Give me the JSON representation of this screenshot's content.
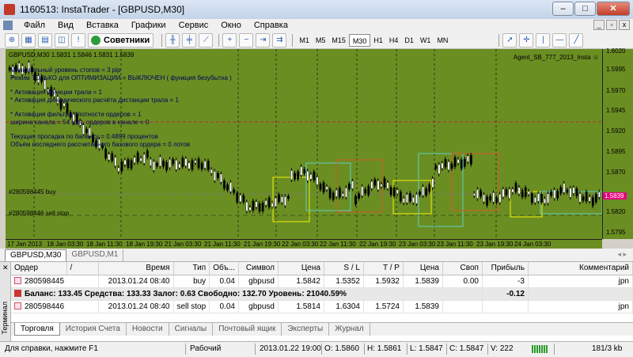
{
  "window": {
    "title": "1160513: InstaTrader - [GBPUSD,M30]",
    "minimize": "‒",
    "maximize": "□",
    "close": "✕"
  },
  "menu": [
    "Файл",
    "Вид",
    "Вставка",
    "Графики",
    "Сервис",
    "Окно",
    "Справка"
  ],
  "mdi_buttons": [
    "_",
    "▫",
    "x"
  ],
  "toolbar": {
    "advisors_label": "Советники",
    "timeframes": [
      "M1",
      "M5",
      "M15",
      "M30",
      "H1",
      "H4",
      "D1",
      "W1",
      "MN"
    ],
    "active_timeframe": "M30"
  },
  "chart": {
    "header": "GBPUSD,M30  1.5831 1.5846 1.5831 1.5839",
    "expert": "Agent_SB_777_2013_Insta ☺",
    "comments": [
      "Минимальный уровень стопов = 3 pip",
      "Режим ТОЛЬКО для ОПТИМИЗАЦИИ = ВЫКЛЮЧЕН ( функция безубытка )",
      "* Активация функции трала = 1",
      "* Активация динамического расчёта дистанции трала = 1",
      "* Активация фильтра плотности ордеров = 1",
      "ширина канала = 54 (pp), ордеров в канале = 0",
      "Текущая просадка по балансу = 0.4899 процентов",
      "Объём последнего рассчитанного базового ордера = 0 лотов"
    ],
    "buy_label": "#280598445 buy",
    "sell_label": "#280598446 sell stop",
    "price_ticks": [
      "1.6020",
      "1.5995",
      "1.5970",
      "1.5945",
      "1.5920",
      "1.5895",
      "1.5870",
      "1.5845",
      "1.5820",
      "1.5795"
    ],
    "current_price": "1.5839",
    "time_ticks": [
      "17 Jan 2013",
      "18 Jan 03:30",
      "18 Jan 11:30",
      "18 Jan 19:30",
      "21 Jan 03:30",
      "21 Jan 11:30",
      "21 Jan 19:30",
      "22 Jan 03:30",
      "22 Jan 11:30",
      "22 Jan 19:30",
      "23 Jan 03:30",
      "23 Jan 11:30",
      "23 Jan 19:30",
      "24 Jan 03:30"
    ],
    "colors": {
      "background": "#6b8e23",
      "bull": "#ffffff",
      "bear": "#000000",
      "buy_line": "#7a7a7a",
      "stop_line": "#b03030"
    }
  },
  "chart_tabs": [
    "GBPUSD,M30",
    "GBPUSD,M1"
  ],
  "terminal": {
    "side_label": "Терминал",
    "columns": [
      "Ордер",
      "/",
      "Время",
      "Тип",
      "Объ...",
      "Символ",
      "Цена",
      "S / L",
      "T / P",
      "Цена",
      "Своп",
      "Прибыль",
      "Комментарий"
    ],
    "rows": [
      {
        "order": "280598445",
        "time": "2013.01.24 08:40",
        "type": "buy",
        "volume": "0.04",
        "symbol": "gbpusd",
        "price": "1.5842",
        "sl": "1.5352",
        "tp": "1.5932",
        "cur": "1.5839",
        "swap": "0.00",
        "profit": "-3",
        "comment": "jpn"
      },
      {
        "order": "280598446",
        "time": "2013.01.24 08:40",
        "type": "sell stop",
        "volume": "0.04",
        "symbol": "gbpusd",
        "price": "1.5814",
        "sl": "1.6304",
        "tp": "1.5724",
        "cur": "1.5839",
        "swap": "",
        "profit": "",
        "comment": "jpn"
      }
    ],
    "balance_text": "Баланс: 133.45  Средства: 133.33  Залог: 0.63  Свободно: 132.70  Уровень: 21040.59%",
    "balance_profit": "-0.12",
    "tabs": [
      "Торговля",
      "История Счета",
      "Новости",
      "Сигналы",
      "Почтовый ящик",
      "Эксперты",
      "Журнал"
    ]
  },
  "status": {
    "help": "Для справки, нажмите F1",
    "profile": "Рабочий",
    "datetime": "2013.01.22 19:00",
    "open": "O: 1.5860",
    "high": "H: 1.5861",
    "low": "L: 1.5847",
    "close": "C: 1.5847",
    "volume": "V: 222",
    "traffic": "181/3 kb"
  }
}
